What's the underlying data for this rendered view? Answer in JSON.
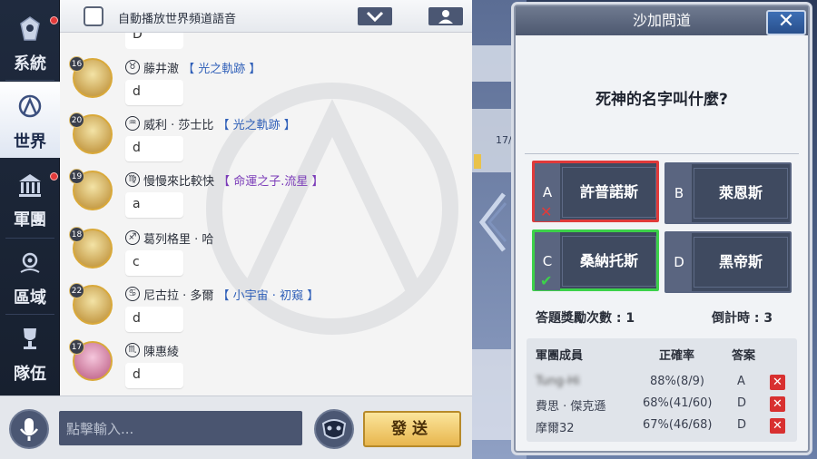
{
  "sidebar": {
    "items": [
      {
        "label": "系統",
        "icon": "system-icon",
        "badge": true
      },
      {
        "label": "世界",
        "icon": "world-icon",
        "active": true
      },
      {
        "label": "軍團",
        "icon": "legion-icon",
        "badge": true
      },
      {
        "label": "區域",
        "icon": "region-icon"
      },
      {
        "label": "隊伍",
        "icon": "team-trophy-icon"
      }
    ]
  },
  "chat": {
    "auto_play_label": "自動播放世界頻道語音",
    "partial_message": "D",
    "messages": [
      {
        "level": "16",
        "sign": "♉",
        "name": "藤井澈",
        "guild": "【 光之軌跡 】",
        "text": "d"
      },
      {
        "level": "20",
        "sign": "♒",
        "name": "威利 · 莎士比",
        "guild": "【 光之軌跡 】",
        "text": "d"
      },
      {
        "level": "19",
        "sign": "♍",
        "name": "慢慢來比較快",
        "guild": "【 命運之子.流星 】",
        "text": "a"
      },
      {
        "level": "18",
        "sign": "♐",
        "name": "葛列格里 · 哈",
        "guild": "",
        "text": "c"
      },
      {
        "level": "22",
        "sign": "♋",
        "name": "尼古拉 · 多爾",
        "guild": "【 小宇宙 · 初窺 】",
        "text": "d"
      },
      {
        "level": "17",
        "sign": "♏",
        "name": "陳惠綾",
        "guild": "",
        "text": "d"
      }
    ]
  },
  "input": {
    "placeholder": "點擊輸入...",
    "send_label": "發送"
  },
  "quiz": {
    "title": "沙加問道",
    "close_label": "✕",
    "question": "死神的名字叫什麼?",
    "options": [
      {
        "letter": "A",
        "text": "許普諾斯",
        "state": "wrong"
      },
      {
        "letter": "B",
        "text": "萊恩斯",
        "state": "normal"
      },
      {
        "letter": "C",
        "text": "桑納托斯",
        "state": "correct"
      },
      {
        "letter": "D",
        "text": "黑帝斯",
        "state": "normal"
      }
    ],
    "reward_label": "答題獎勵次數 : 1",
    "timer_label": "倒計時 : 3",
    "table": {
      "headers": [
        "軍團成員",
        "正確率",
        "答案"
      ],
      "rows": [
        {
          "member": "Tung-Hi",
          "rate": "88%(8/9)",
          "answer": "A",
          "blurred": true
        },
        {
          "member": "費思 · 傑克遜",
          "rate": "68%(41/60)",
          "answer": "D"
        },
        {
          "member": "摩爾32",
          "rate": "67%(46/68)",
          "answer": "D"
        }
      ]
    }
  },
  "background": {
    "tag": "17/"
  },
  "colors": {
    "wrong": "#e03a3a",
    "correct": "#3cd14a",
    "send": "#e8b64e",
    "guild": "#2f5fb8"
  }
}
